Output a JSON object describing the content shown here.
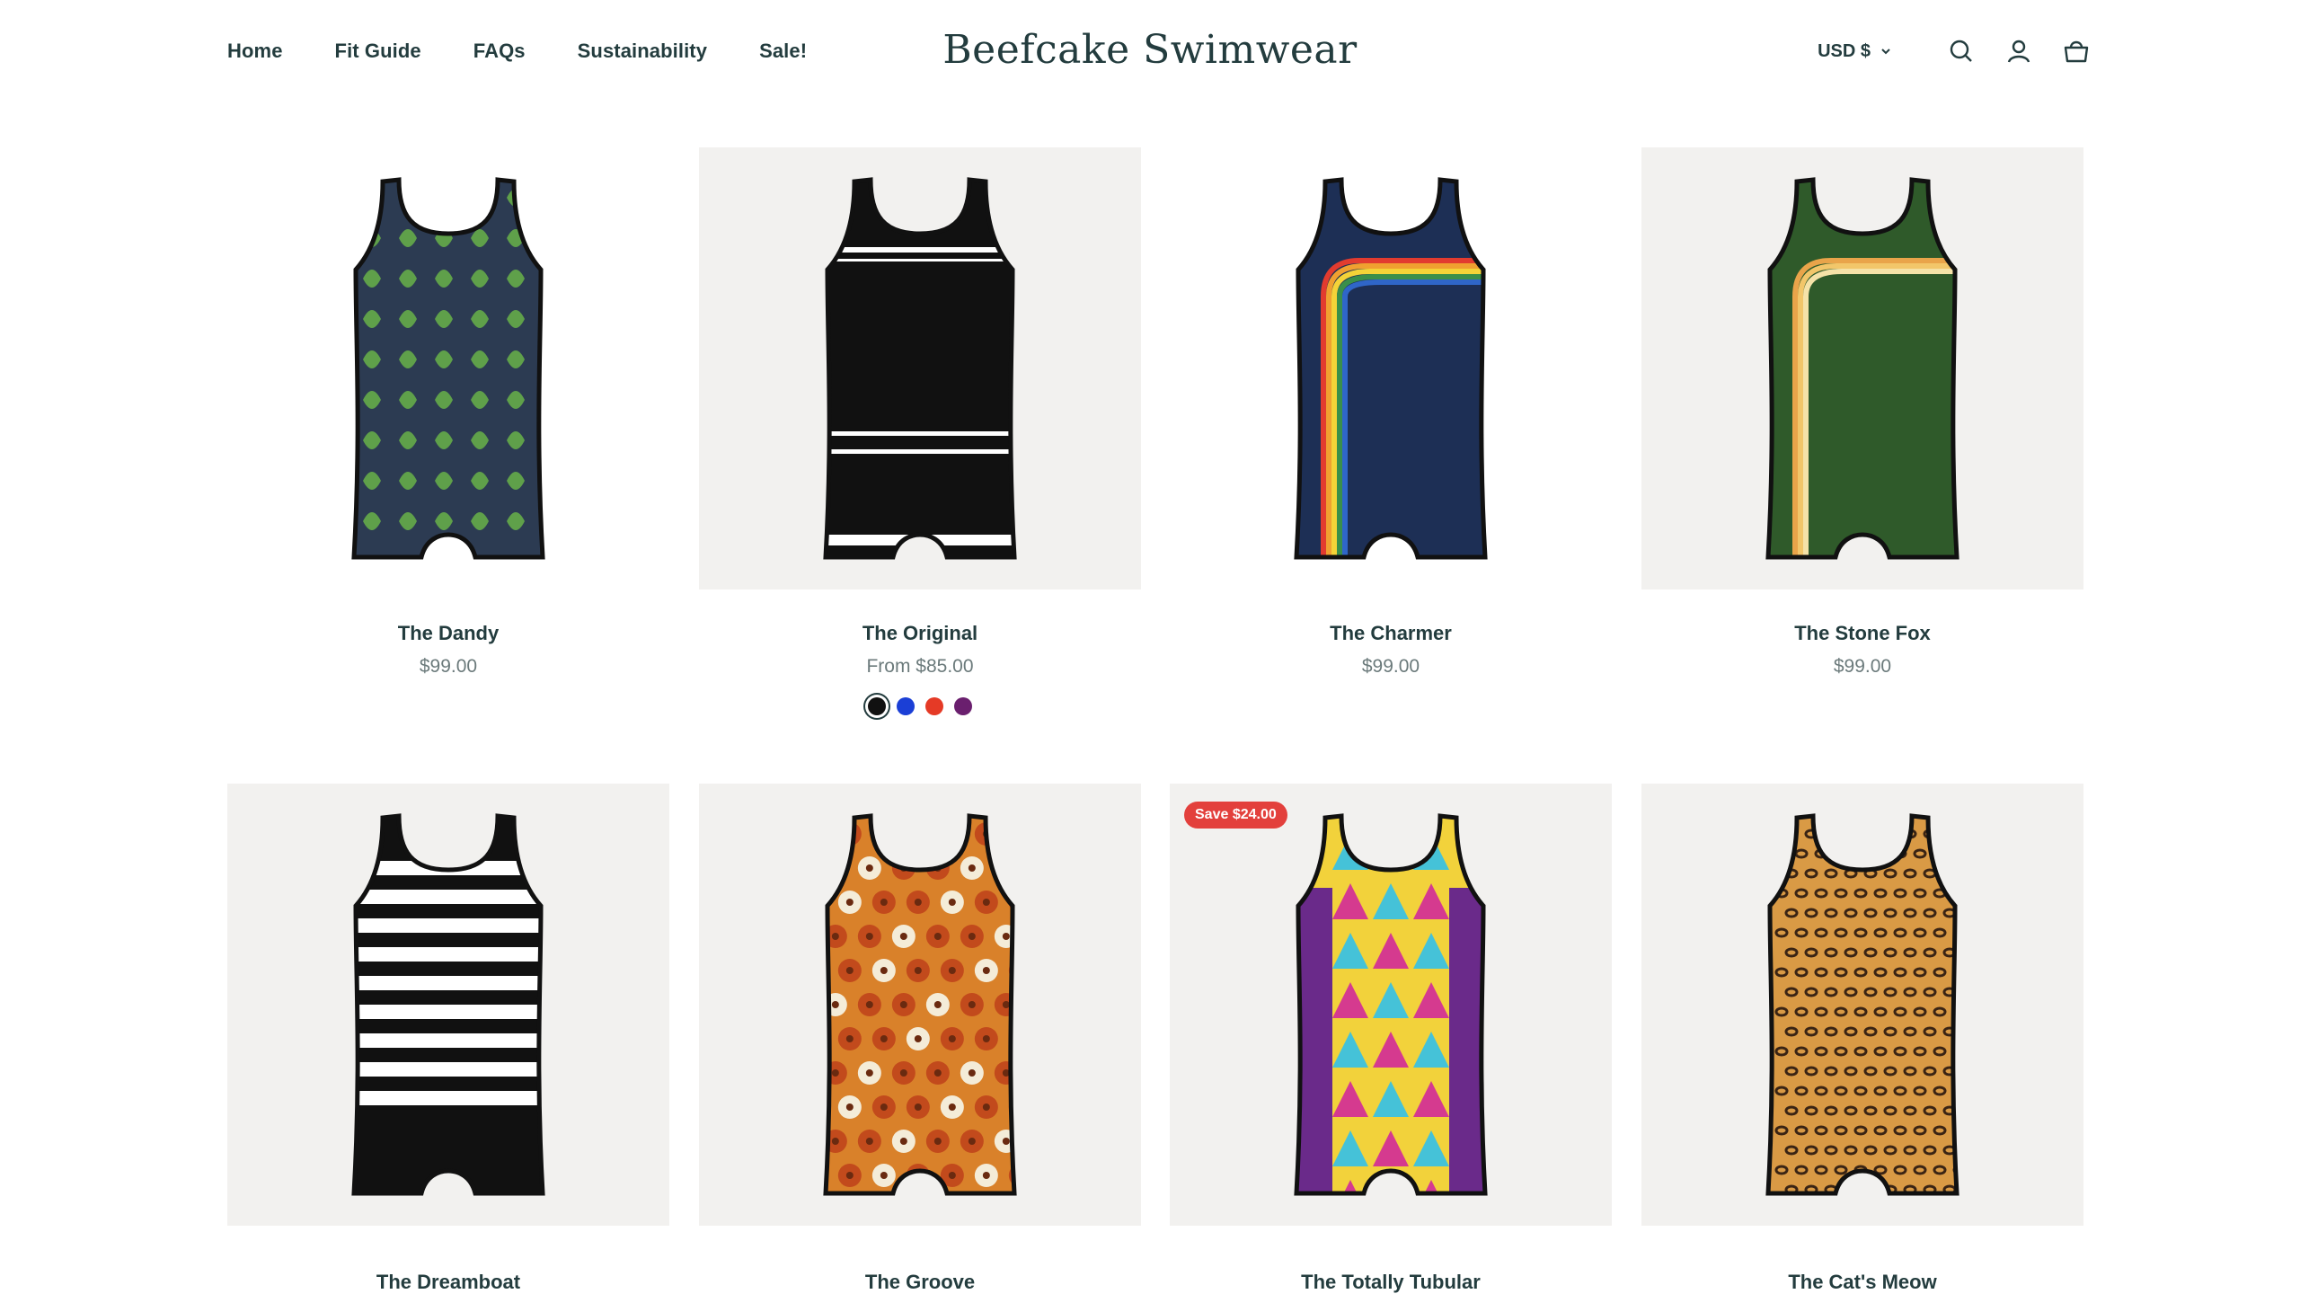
{
  "header": {
    "nav": [
      "Home",
      "Fit Guide",
      "FAQs",
      "Sustainability",
      "Sale!"
    ],
    "logo": "Beefcake Swimwear",
    "currency": "USD $"
  },
  "products": [
    {
      "title": "The Dandy",
      "price": "$99.00",
      "body_color": "#2c3b52",
      "pattern": "damask",
      "accent": "#5fa04a"
    },
    {
      "title": "The Original",
      "price": "From $85.00",
      "body_color": "#111111",
      "pattern": "stripes-white-bands",
      "accent": "#ffffff",
      "swatches": [
        "#111111",
        "#1b3fd6",
        "#e53a26",
        "#6a1f6e"
      ]
    },
    {
      "title": "The Charmer",
      "price": "$99.00",
      "body_color": "#1d2f55",
      "pattern": "rainbow",
      "accent": "#f0a030"
    },
    {
      "title": "The Stone Fox",
      "price": "$99.00",
      "body_color": "#2f5a2a",
      "pattern": "rainbow-warm",
      "accent": "#f2c66a"
    },
    {
      "title": "The Dreamboat",
      "price": "",
      "body_color": "#111111",
      "pattern": "horizontal-stripes",
      "accent": "#ffffff"
    },
    {
      "title": "The Groove",
      "price": "",
      "body_color": "#d9812a",
      "pattern": "flowers",
      "accent": "#c24a1c"
    },
    {
      "title": "The Totally Tubular",
      "price": "",
      "body_color": "#f2d23b",
      "pattern": "triangles",
      "accent": "#d53a8f",
      "badge": "Save $24.00"
    },
    {
      "title": "The Cat's Meow",
      "price": "",
      "body_color": "#d99a45",
      "pattern": "leopard",
      "accent": "#3a2414"
    }
  ]
}
